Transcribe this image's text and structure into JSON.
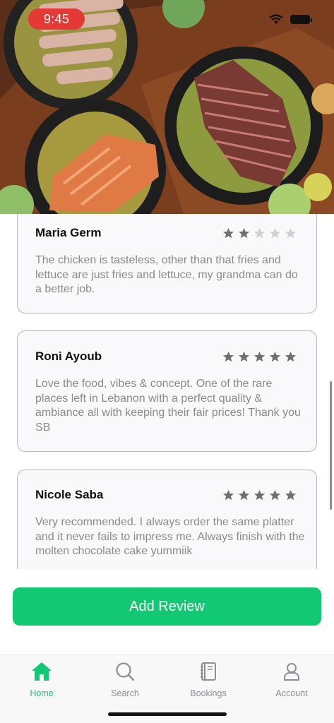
{
  "status_bar": {
    "time": "9:45"
  },
  "colors": {
    "accent": "#13c872",
    "star_filled": "#6e6e73",
    "star_empty": "#d0d0d4",
    "time_pill": "#e53935"
  },
  "reviews": [
    {
      "name": "Maria Germ",
      "rating": 2,
      "text": "The chicken is tasteless, other than that fries and lettuce are just fries and lettuce, my grandma can do a better job."
    },
    {
      "name": "Roni Ayoub",
      "rating": 5,
      "text": "Love the food, vibes & concept. One of the rare places left in Lebanon with a perfect quality & ambiance all with keeping their fair prices! Thank you SB"
    },
    {
      "name": "Nicole Saba",
      "rating": 5,
      "text": "Very recommended. I always order the same platter and it never fails to impress me. Always finish with the molten chocolate cake yummiik"
    }
  ],
  "add_review_label": "Add Review",
  "tabs": [
    {
      "label": "Home",
      "icon": "home-icon",
      "active": true
    },
    {
      "label": "Search",
      "icon": "search-icon",
      "active": false
    },
    {
      "label": "Bookings",
      "icon": "bookings-icon",
      "active": false
    },
    {
      "label": "Account",
      "icon": "account-icon",
      "active": false
    }
  ]
}
